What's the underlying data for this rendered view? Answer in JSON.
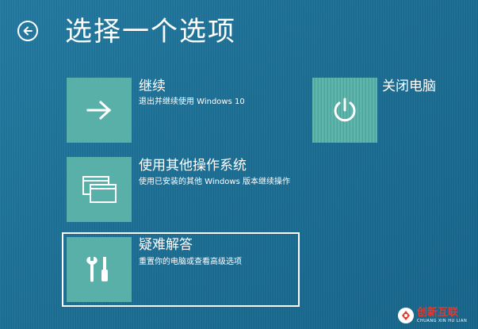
{
  "header": {
    "title": "选择一个选项",
    "back_icon": "arrow-left-circle-icon"
  },
  "options": {
    "continue": {
      "title": "继续",
      "description": "退出并继续使用 Windows 10",
      "icon": "arrow-right-icon"
    },
    "other_os": {
      "title": "使用其他操作系统",
      "description": "使用已安装的其他 Windows 版本继续操作",
      "icon": "windows-stack-icon"
    },
    "troubleshoot": {
      "title": "疑难解答",
      "description": "重置你的电脑或查看高级选项",
      "icon": "tools-icon",
      "selected": true
    },
    "shutdown": {
      "title": "关闭电脑",
      "icon": "power-icon"
    }
  },
  "watermark": {
    "name": "创新互联",
    "sub": "CHUANG XIN HU LIAN"
  },
  "colors": {
    "background": "#1d6f96",
    "tile": "#58b0a8",
    "text": "#ffffff",
    "watermark_red": "#e23a2f"
  }
}
